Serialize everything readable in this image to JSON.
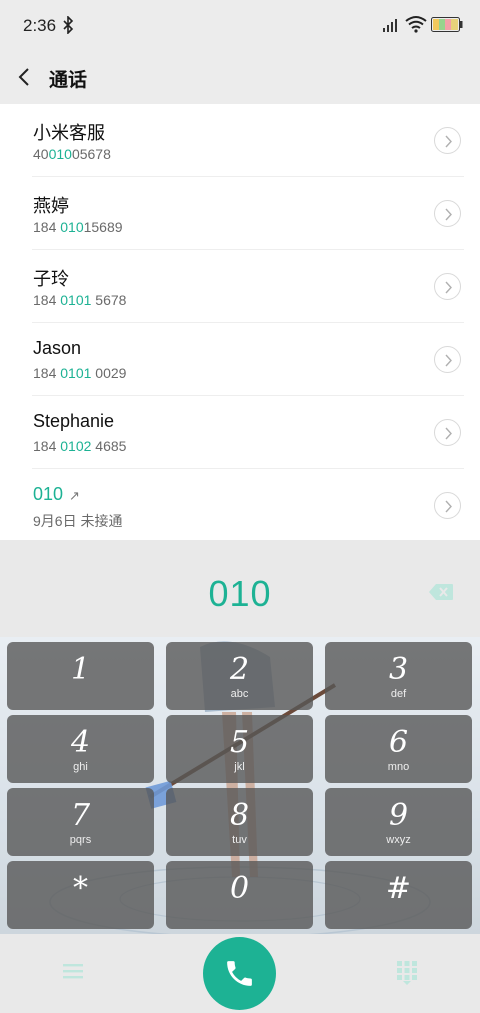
{
  "status_bar": {
    "time": "2:36"
  },
  "header": {
    "title": "通话"
  },
  "contacts": [
    {
      "name": "小米客服",
      "num_pre": "40",
      "num_hl": "010",
      "num_post": "05678"
    },
    {
      "name": "燕婷",
      "num_pre": "184 ",
      "num_hl": "010",
      "num_post": "15689"
    },
    {
      "name": "子玲",
      "num_pre": "184 ",
      "num_hl": "0101",
      "num_post": " 5678"
    },
    {
      "name": "Jason",
      "num_pre": "184 ",
      "num_hl": "0101",
      "num_post": " 0029"
    },
    {
      "name": "Stephanie",
      "num_pre": "184 ",
      "num_hl": "0102",
      "num_post": " 4685"
    }
  ],
  "recent": {
    "number": "010",
    "arrow": "↗",
    "detail": "9月6日 未接通"
  },
  "dialer": {
    "entered": "010"
  },
  "keypad": [
    {
      "digit": "1",
      "letters": ""
    },
    {
      "digit": "2",
      "letters": "abc"
    },
    {
      "digit": "3",
      "letters": "def"
    },
    {
      "digit": "4",
      "letters": "ghi"
    },
    {
      "digit": "5",
      "letters": "jkl"
    },
    {
      "digit": "6",
      "letters": "mno"
    },
    {
      "digit": "7",
      "letters": "pqrs"
    },
    {
      "digit": "8",
      "letters": "tuv"
    },
    {
      "digit": "9",
      "letters": "wxyz"
    },
    {
      "digit": "*",
      "letters": ""
    },
    {
      "digit": "0",
      "letters": ""
    },
    {
      "digit": "#",
      "letters": ""
    }
  ],
  "colors": {
    "accent": "#1db294",
    "key_bg": "#585858",
    "list_bg": "#ffffff"
  },
  "icons": {
    "bluetooth": "bluetooth-icon",
    "signal": "signal-icon",
    "wifi": "wifi-icon",
    "battery": "battery-icon",
    "back": "chevron-left-icon",
    "detail": "chevron-right-circle-icon",
    "delete": "backspace-icon",
    "menu": "menu-icon",
    "call": "phone-icon",
    "dialpad": "dialpad-icon"
  }
}
